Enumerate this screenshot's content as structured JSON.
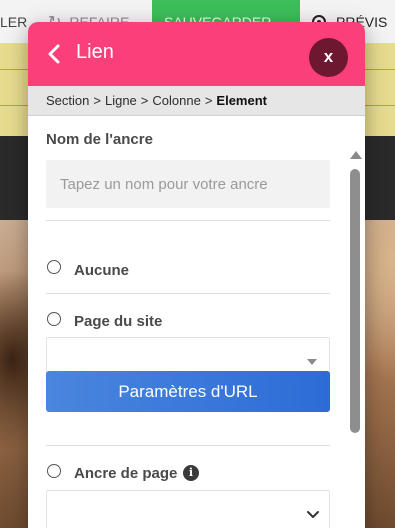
{
  "toolbar": {
    "cancel_label": "LER",
    "redo_label": "REFAIRE",
    "save_label": "SAUVEGARDER",
    "preview_label": "PRÉVIS"
  },
  "modal": {
    "title": "Lien",
    "close_label": "x"
  },
  "breadcrumb": {
    "items": [
      "Section",
      "Ligne",
      "Colonne"
    ],
    "separator": ">",
    "current": "Element"
  },
  "anchor_name": {
    "label": "Nom de l'ancre",
    "placeholder": "Tapez un nom pour votre ancre",
    "value": ""
  },
  "link_options": {
    "none_label": "Aucune",
    "site_page_label": "Page du site",
    "site_page_value": "",
    "url_settings_button": "Paramètres d'URL",
    "page_anchor_label": "Ancre de page",
    "page_anchor_value": ""
  },
  "colors": {
    "header": "#fb3f7a",
    "close_button": "#6d1730",
    "primary_button": "#2c6cd6",
    "save_button": "#3dbd5a"
  },
  "icons": {
    "back": "chevron-left-icon",
    "close": "close-icon",
    "info": "info-icon",
    "redo": "redo-icon",
    "preview": "eye-icon"
  }
}
